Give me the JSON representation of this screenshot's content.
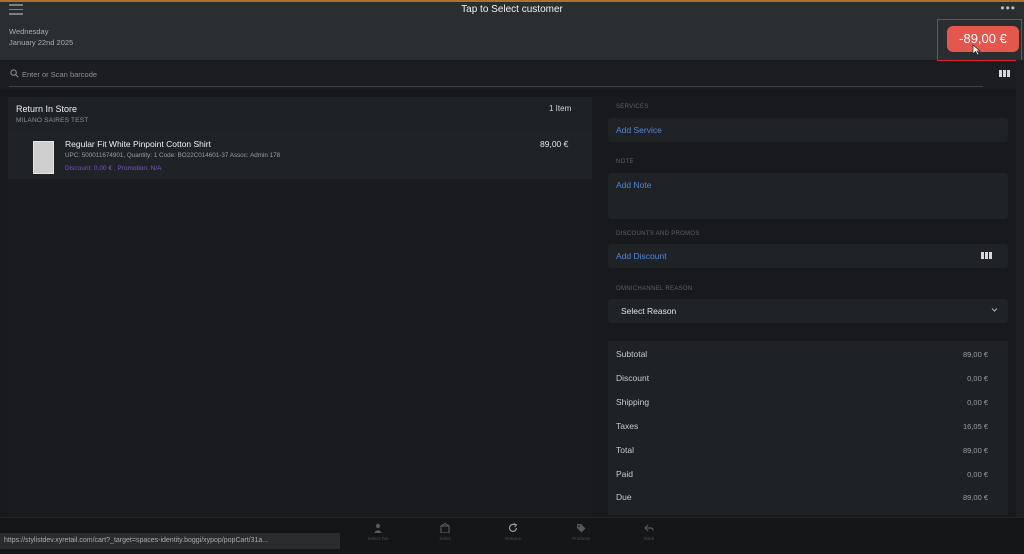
{
  "header": {
    "title": "Tap to Select customer",
    "day": "Wednesday",
    "date": "January 22nd 2025",
    "amount_due": "-89,00 €",
    "more_icon": "ellipsis-icon",
    "menu_icon": "hamburger-menu-icon"
  },
  "search": {
    "placeholder": "Enter or Scan barcode"
  },
  "cart": {
    "title": "Return In Store",
    "store": "MILANO SAIRES TEST",
    "item_count": "1 Item",
    "items": [
      {
        "name": "Regular Fit White Pinpoint Cotton Shirt",
        "meta": "UPC: 500011674901, Quantity: 1 Code: BO22C014601-37 Assoc: Admin 178",
        "discount": "Discount: 0,00 € , Promotion: N/A",
        "price": "89,00 €"
      }
    ]
  },
  "services": {
    "label": "SERVICES",
    "add": "Add Service"
  },
  "note": {
    "label": "NOTE",
    "add": "Add Note"
  },
  "discounts": {
    "label": "DISCOUNTS AND PROMOS",
    "add": "Add Discount"
  },
  "omnichannel": {
    "label": "OMNICHANNEL REASON",
    "selected": "Select Reason"
  },
  "totals": [
    {
      "label": "Subtotal",
      "value": "89,00 €"
    },
    {
      "label": "Discount",
      "value": "0,00 €"
    },
    {
      "label": "Shipping",
      "value": "0,00 €"
    },
    {
      "label": "Taxes",
      "value": "16,05 €"
    },
    {
      "label": "Total",
      "value": "89,00 €"
    },
    {
      "label": "Paid",
      "value": "0,00 €"
    },
    {
      "label": "Due",
      "value": "89,00 €"
    }
  ],
  "bottom_nav": [
    {
      "label": "Select Tab",
      "icon": "person-icon"
    },
    {
      "label": "Sales",
      "icon": "store-icon"
    },
    {
      "label": "Returns",
      "icon": "refresh-icon"
    },
    {
      "label": "Products",
      "icon": "tag-icon"
    },
    {
      "label": "Back",
      "icon": "back-arrow-icon"
    }
  ],
  "status_url": "https://stylistdev.xyretail.com/cart?_target=spaces-identity.boggi/xypop/popCart/31a...",
  "colors": {
    "accent_red": "#e4574c",
    "link_blue": "#4f86d8",
    "promo_purple": "#7c4fc2"
  }
}
